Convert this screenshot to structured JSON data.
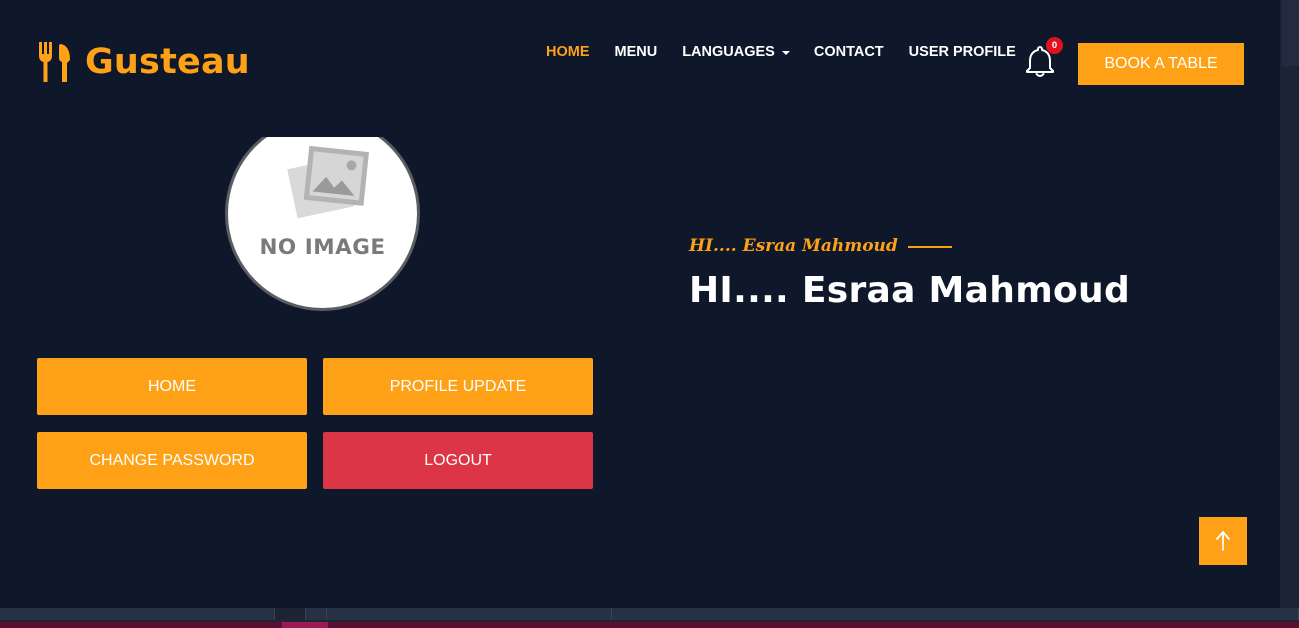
{
  "brand": {
    "name": "Gusteau",
    "icon": "utensils-icon"
  },
  "nav": {
    "items": [
      {
        "label": "HOME",
        "active": true
      },
      {
        "label": "MENU",
        "active": false
      },
      {
        "label": "LANGUAGES",
        "active": false,
        "dropdown": true
      },
      {
        "label": "CONTACT",
        "active": false
      },
      {
        "label": "USER PROFILE",
        "active": false
      }
    ],
    "notifications": {
      "icon": "bell-icon",
      "count": "0"
    },
    "cta_label": "BOOK A TABLE"
  },
  "profile": {
    "avatar_placeholder": "NO IMAGE",
    "greeting_small": "HI.... Esraa Mahmoud",
    "greeting_large": "HI.... Esraa Mahmoud",
    "actions": {
      "home": "HOME",
      "profile_update": "PROFILE UPDATE",
      "change_password": "CHANGE PASSWORD",
      "logout": "LOGOUT"
    }
  },
  "back_to_top": {
    "icon": "arrow-up-icon"
  },
  "colors": {
    "accent": "#fea116",
    "background": "#0f172b",
    "danger": "#dc3545",
    "text": "#ffffff"
  }
}
